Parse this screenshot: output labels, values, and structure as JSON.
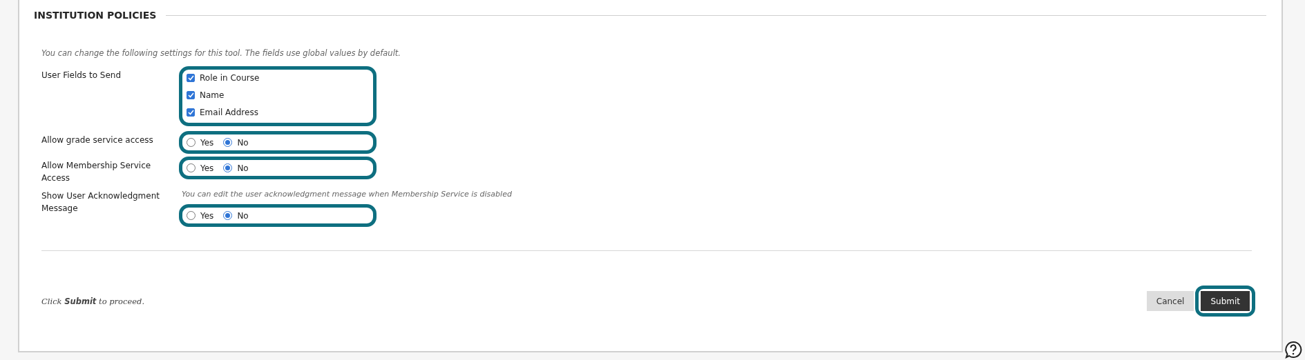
{
  "section": {
    "title": "INSTITUTION POLICIES"
  },
  "intro": "You can change the following settings for this tool. The fields use global values by default.",
  "fields": [
    {
      "kind": "checkboxes",
      "label": "User Fields to Send",
      "highlighted": true,
      "options": [
        {
          "label": "Role in Course",
          "checked": true
        },
        {
          "label": "Name",
          "checked": true
        },
        {
          "label": "Email Address",
          "checked": true
        }
      ]
    },
    {
      "kind": "radios",
      "label": "Allow grade service access",
      "highlighted": true,
      "options": [
        {
          "label": "Yes",
          "selected": false
        },
        {
          "label": "No",
          "selected": true
        }
      ]
    },
    {
      "kind": "radios",
      "label": "Allow Membership Service Access",
      "highlighted": true,
      "options": [
        {
          "label": "Yes",
          "selected": false
        },
        {
          "label": "No",
          "selected": true
        }
      ]
    },
    {
      "kind": "radios",
      "label": "Show User Acknowledgment Message",
      "note": "You can edit the user acknowledgment message when Membership Service is disabled",
      "highlighted": true,
      "options": [
        {
          "label": "Yes",
          "selected": false
        },
        {
          "label": "No",
          "selected": true
        }
      ]
    }
  ],
  "footer": {
    "hint": "Click **Submit** to proceed.",
    "buttons": [
      {
        "kind": "secondary",
        "label": "Cancel",
        "highlighted": false
      },
      {
        "kind": "primary",
        "label": "Submit",
        "highlighted": true
      }
    ]
  }
}
